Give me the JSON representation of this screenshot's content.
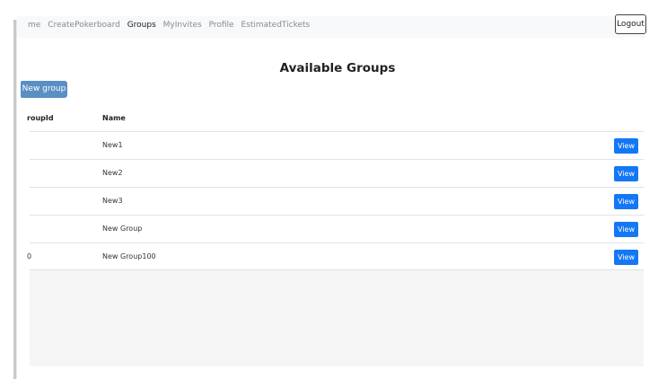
{
  "nav": {
    "links": [
      {
        "label": "me",
        "active": false
      },
      {
        "label": "CreatePokerboard",
        "active": false
      },
      {
        "label": "Groups",
        "active": true
      },
      {
        "label": "MyInvites",
        "active": false
      },
      {
        "label": "Profile",
        "active": false
      },
      {
        "label": "EstimatedTickets",
        "active": false
      }
    ],
    "logout_label": "Logout"
  },
  "page": {
    "title": "Available Groups",
    "new_group_label": "New group"
  },
  "table": {
    "columns": [
      "roupId",
      "Name"
    ],
    "rows": [
      {
        "id": "",
        "name": "New1",
        "action": "View"
      },
      {
        "id": "",
        "name": "New2",
        "action": "View"
      },
      {
        "id": "",
        "name": "New3",
        "action": "View"
      },
      {
        "id": "",
        "name": "New Group",
        "action": "View"
      },
      {
        "id": "0",
        "name": "New Group100",
        "action": "View"
      }
    ]
  },
  "colors": {
    "primary": "#1477f5",
    "new_group_button": "#5a8fc4",
    "navbar_bg": "#f8f9fa"
  }
}
